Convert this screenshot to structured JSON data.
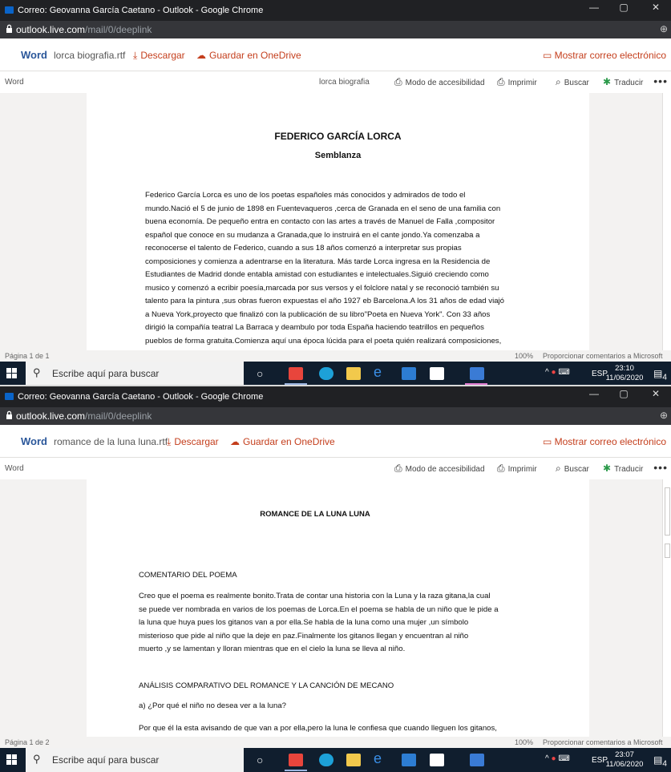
{
  "browser": {
    "window_title": "Correo: Geovanna García Caetano - Outlook - Google Chrome",
    "minimize": "—",
    "restore": "▢",
    "close": "✕",
    "url_host": "outlook.live.com",
    "url_path": "/mail/0/deeplink",
    "new_tab": "⊕"
  },
  "viewer": {
    "brand": "Word",
    "download": "Descargar",
    "save_onedrive": "Guardar en OneDrive",
    "show_email": "Mostrar correo electrónico",
    "ribbon_label": "Word",
    "accessibility": "Modo de accesibilidad",
    "print": "Imprimir",
    "find": "Buscar",
    "translate": "Traducir",
    "more": "•••",
    "zoom": "100%",
    "feedback": "Proporcionar comentarios a Microsoft"
  },
  "taskbar": {
    "search_placeholder": "Escribe aquí para buscar",
    "lang": "ESP",
    "tray_chevron": "^"
  },
  "shot1": {
    "file_name": "lorca biografia.rtf",
    "doc_title_center": "lorca biografia",
    "page_status": "Página 1 de 1",
    "time": "23:10",
    "date": "11/06/2020",
    "notifications": "4",
    "document": {
      "title": "FEDERICO GARCÍA LORCA",
      "subtitle": "Semblanza",
      "lines": [
        "Federico García Lorca es uno de los poetas españoles más conocidos y admirados de todo el",
        "mundo.Nació el 5 de junio de 1898 en Fuentevaqueros ,cerca de Granada en el seno de una familia con",
        "buena economía. De pequeño entra en contacto con las artes a través de Manuel de Falla ,compositor",
        "español que conoce en su mudanza a Granada,que lo instruirá en el cante jondo.Ya comenzaba a",
        "reconocerse el talento de Federico, cuando a sus 18 años comenzó a interpretar sus propias",
        "composiciones y comienza a adentrarse en la literatura. Más tarde Lorca ingresa en la Residencia de",
        "Estudiantes de Madrid donde entabla amistad con estudiantes e intelectuales.Siguió creciendo como",
        "musico y comenzó a ecribir poesía,marcada por sus versos y el folclore natal y se reconoció también su",
        "talento para la pintura ,sus obras fueron expuestas el año 1927 eb Barcelona.A los 31 años de edad viajó",
        "a Nueva York,proyecto que finalizó con la publicación de su libro\"Poeta en Nueva York\". Con 33 años",
        "dirigió la compañía teatral La Barraca y deambulo por toda España haciendo teatrillos en pequeños",
        "pueblos de forma gratuita.Comienza aquí una época lúcida para el poeta quién realizará composiciones,"
      ]
    }
  },
  "shot2": {
    "file_name": "romance de la luna luna.rtf",
    "page_status": "Página 1 de 2",
    "time": "23:07",
    "date": "11/06/2020",
    "notifications": "4",
    "document": {
      "title": "ROMANCE DE LA LUNA LUNA",
      "heading_commentary": "COMENTARIO DEL POEMA",
      "commentary_lines": [
        "Creo que el poema es realmente bonito.Trata de contar una historia con la Luna y la raza gitana,la cual",
        "se puede ver nombrada en varios de los poemas de Lorca.En el poema se habla de un niño que le pide a",
        "la luna que huya pues los gitanos van a por ella.Se habla de la luna como una mujer ,un símbolo",
        "misterioso que pide al niño que la deje en paz.Finalmente los gitanos llegan y encuentran al niño",
        "muerto ,y se lamentan y lloran mientras que en el cielo la luna se lleva al niño."
      ],
      "heading_analysis": "ANÁLISIS COMPARATIVO DEL ROMANCE Y LA CANCIÓN DE MECANO",
      "question_a": "a) ¿Por qué el niño no desea ver a la luna?",
      "answer_a": "Por que él la esta avisando de que van a por ella,pero la luna le confiesa que cuando lleguen los gitanos,"
    }
  }
}
